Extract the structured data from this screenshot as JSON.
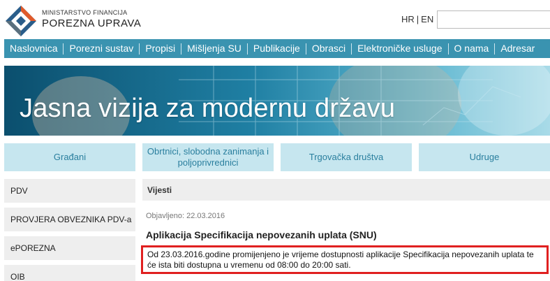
{
  "header": {
    "ministry": "MINISTARSTVO FINANCIJA",
    "agency": "POREZNA UPRAVA",
    "lang_hr": "HR",
    "lang_sep": "|",
    "lang_en": "EN"
  },
  "nav": {
    "items": [
      "Naslovnica",
      "Porezni sustav",
      "Propisi",
      "Mišljenja SU",
      "Publikacije",
      "Obrasci",
      "Elektroničke usluge",
      "O nama",
      "Adresar"
    ]
  },
  "banner": {
    "title": "Jasna vizija za modernu državu"
  },
  "tiles": [
    "Građani",
    "Obrtnici, slobodna zanimanja i poljoprivrednici",
    "Trgovačka društva",
    "Udruge"
  ],
  "sidebar": {
    "items": [
      "PDV",
      "PROVJERA OBVEZNIKA PDV-a",
      "ePOREZNA",
      "OIB"
    ]
  },
  "main": {
    "section": "Vijesti",
    "published": "Objavljeno: 22.03.2016",
    "title": "Aplikacija Specifikacija nepovezanih uplata (SNU)",
    "notice": "Od 23.03.2016.godine promijenjeno je vrijeme dostupnosti aplikacije Specifikacija nepovezanih uplata te će ista biti dostupna u vremenu od 08:00 do 20:00 sati."
  },
  "colors": {
    "nav": "#3a93b0",
    "tile": "#c6e6ef",
    "tile_text": "#2a7f9e",
    "highlight_border": "#e02020"
  }
}
